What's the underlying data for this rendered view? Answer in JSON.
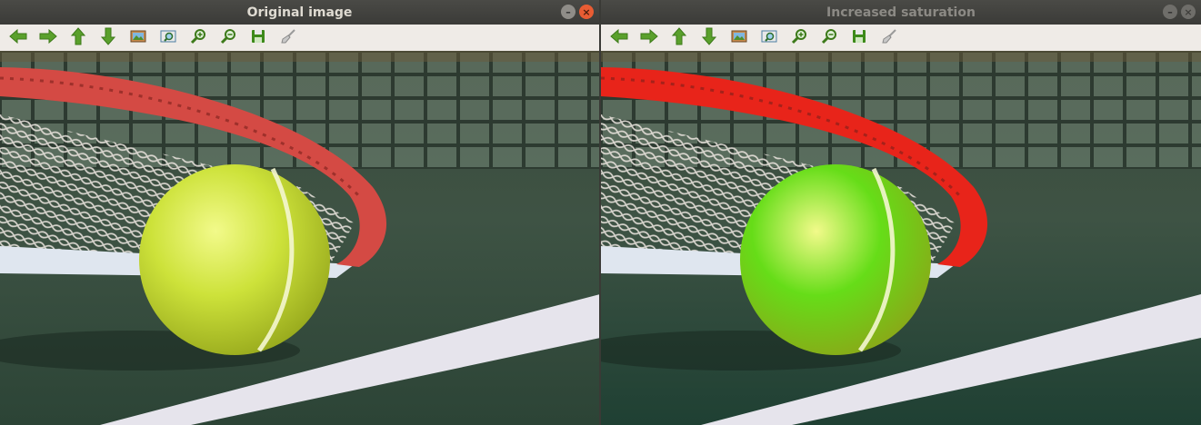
{
  "windows": [
    {
      "title": "Original image",
      "active": true
    },
    {
      "title": "Increased saturation",
      "active": false
    }
  ],
  "toolbar": {
    "buttons": [
      "arrow-left-icon",
      "arrow-right-icon",
      "arrow-up-icon",
      "arrow-down-icon",
      "image-icon",
      "zoom-fit-icon",
      "zoom-in-icon",
      "zoom-out-icon",
      "save-icon",
      "brush-icon"
    ]
  },
  "colors": {
    "racket_original": "#d44a44",
    "racket_saturated": "#e8241a",
    "ball_original": "#cde23a",
    "ball_saturated": "#66dd18",
    "court_original": "#2c4436",
    "court_saturated": "#1f4033"
  }
}
